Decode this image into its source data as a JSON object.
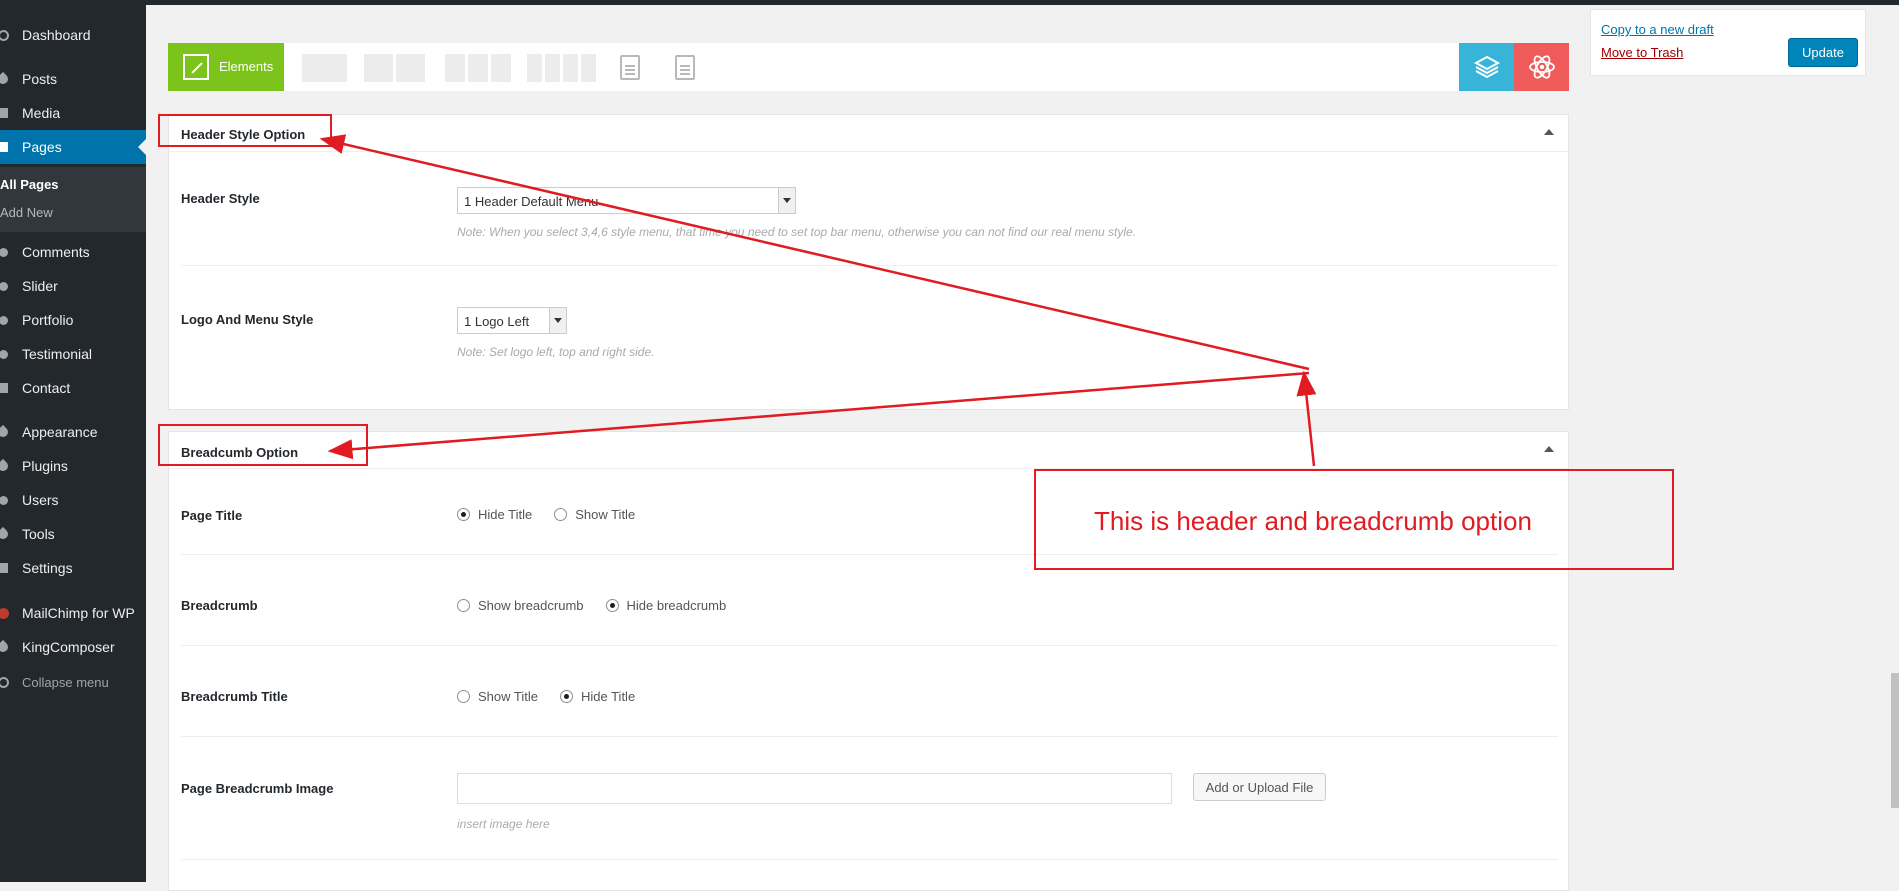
{
  "sidebar": {
    "items": [
      {
        "label": "Dashboard",
        "icon": "dashboard-icon"
      },
      {
        "label": "Posts",
        "icon": "pin-icon"
      },
      {
        "label": "Media",
        "icon": "media-icon"
      },
      {
        "label": "Pages",
        "icon": "page-icon",
        "active": true
      },
      {
        "label": "Comments",
        "icon": "comment-icon"
      },
      {
        "label": "Slider",
        "icon": "slider-icon"
      },
      {
        "label": "Portfolio",
        "icon": "portfolio-icon"
      },
      {
        "label": "Testimonial",
        "icon": "testimonial-icon"
      },
      {
        "label": "Contact",
        "icon": "contact-icon"
      },
      {
        "label": "Appearance",
        "icon": "appearance-icon"
      },
      {
        "label": "Plugins",
        "icon": "plugin-icon"
      },
      {
        "label": "Users",
        "icon": "users-icon"
      },
      {
        "label": "Tools",
        "icon": "tools-icon"
      },
      {
        "label": "Settings",
        "icon": "settings-icon"
      },
      {
        "label": "MailChimp for WP",
        "icon": "mailchimp-icon"
      },
      {
        "label": "KingComposer",
        "icon": "kingcomposer-icon"
      },
      {
        "label": "Collapse menu",
        "icon": "collapse-icon"
      }
    ],
    "submenu": [
      {
        "label": "All Pages",
        "current": true
      },
      {
        "label": "Add New"
      }
    ]
  },
  "toolbar": {
    "elements_label": "Elements",
    "accent_color": "#7cc41b",
    "layers_color": "#39b4d9",
    "atom_color": "#ef5a5a"
  },
  "publish": {
    "copy_draft": "Copy to a new draft",
    "move_trash": "Move to Trash",
    "update": "Update"
  },
  "header_panel": {
    "title": "Header Style Option",
    "header_style": {
      "label": "Header Style",
      "value": "1 Header Default Menu",
      "note": "Note: When you select 3,4,6 style menu, that time you need to set top bar menu, otherwise you can not find our real menu style."
    },
    "logo_style": {
      "label": "Logo And Menu Style",
      "value": "1 Logo Left",
      "note": "Note: Set logo left, top and right side."
    }
  },
  "breadcrumb_panel": {
    "title": "Breadcumb Option",
    "page_title": {
      "label": "Page Title",
      "opt1": "Hide Title",
      "opt2": "Show Title",
      "selected": "Hide Title"
    },
    "breadcrumb": {
      "label": "Breadcrumb",
      "opt1": "Show breadcrumb",
      "opt2": "Hide breadcrumb",
      "selected": "Hide breadcrumb"
    },
    "breadcrumb_title": {
      "label": "Breadcrumb Title",
      "opt1": "Show Title",
      "opt2": "Hide Title",
      "selected": "Hide Title"
    },
    "breadcrumb_image": {
      "label": "Page Breadcrumb Image",
      "upload": "Add or Upload File",
      "hint": "insert image here"
    }
  },
  "annotation": {
    "text": "This is header and breadcrumb option",
    "color": "#e01b22"
  }
}
